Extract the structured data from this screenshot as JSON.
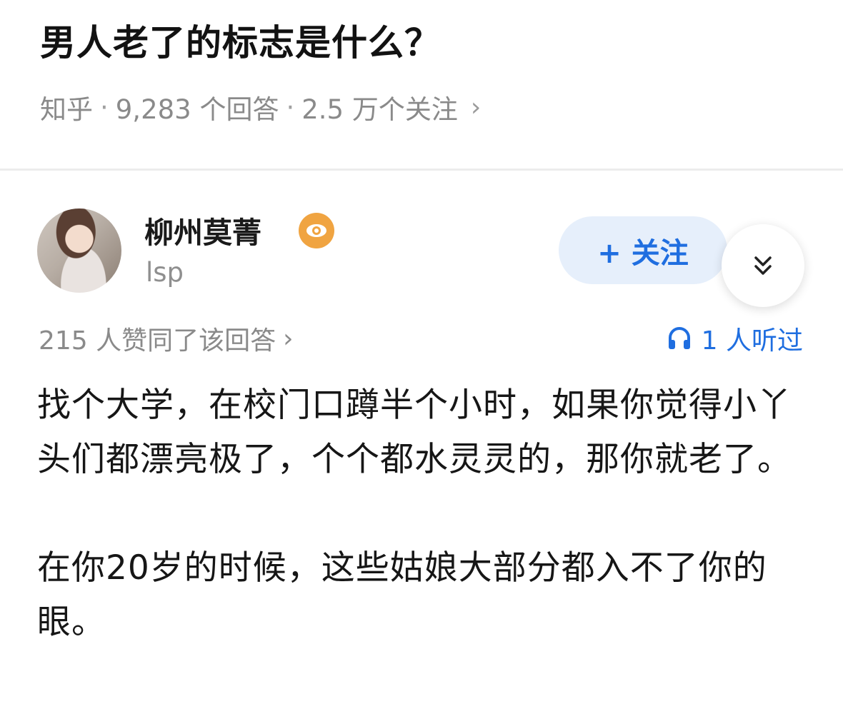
{
  "question": {
    "title": "男人老了的标志是什么？",
    "source": "知乎",
    "sep": "·",
    "answers": "9,283 个回答",
    "followers": "2.5 万个关注",
    "chevron": "›"
  },
  "author": {
    "name": "柳州莫菁",
    "bio": "lsp",
    "badge_icon": "eye-badge-icon",
    "follow_label": "+ 关注",
    "expand_icon": "double-chevron-down-icon"
  },
  "stats": {
    "upvotes": "215 人赞同了该回答",
    "upvotes_chevron": "›",
    "listeners": "1 人听过",
    "listen_icon": "headphones-icon"
  },
  "answer": {
    "paragraph_1": "找个大学，在校门口蹲半个小时，如果你觉得小丫头们都漂亮极了，个个都水灵灵的，那你就老了。",
    "paragraph_2": "在你20岁的时候，这些姑娘大部分都入不了你的眼。"
  },
  "colors": {
    "accent": "#1f6ee0",
    "follow_bg": "#e6effb",
    "badge": "#f0a441",
    "meta_text": "#8a8a8a"
  }
}
